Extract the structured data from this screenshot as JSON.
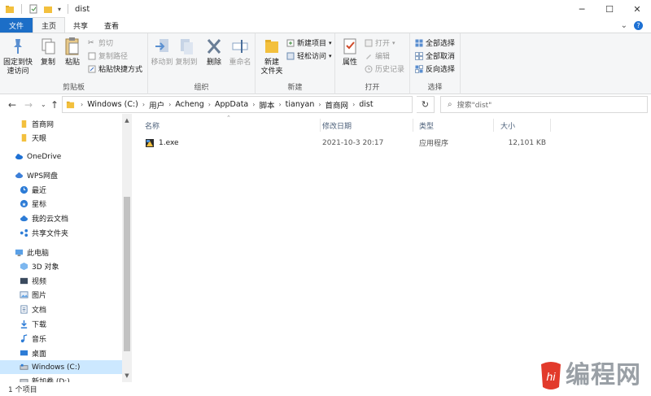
{
  "window": {
    "title": "dist",
    "controls": {
      "minimize": "─",
      "maximize": "☐",
      "close": "✕"
    }
  },
  "ribbon_tabs": [
    {
      "label": "文件"
    },
    {
      "label": "主页"
    },
    {
      "label": "共享"
    },
    {
      "label": "查看"
    }
  ],
  "ribbon": {
    "clipboard": {
      "label": "剪贴板",
      "pin": "固定到快\n速访问",
      "copy": "复制",
      "paste": "粘贴",
      "cut": "剪切",
      "copy_path": "复制路径",
      "paste_shortcut": "粘贴快捷方式"
    },
    "organize": {
      "label": "组织",
      "move_to": "移动到",
      "copy_to": "复制到",
      "delete": "删除",
      "rename": "重命名"
    },
    "new": {
      "label": "新建",
      "new_folder": "新建\n文件夹",
      "new_item": "新建项目",
      "easy_access": "轻松访问"
    },
    "open": {
      "label": "打开",
      "properties": "属性",
      "open": "打开",
      "edit": "编辑",
      "history": "历史记录"
    },
    "select": {
      "label": "选择",
      "select_all": "全部选择",
      "select_none": "全部取消",
      "invert": "反向选择"
    }
  },
  "address": {
    "crumbs": [
      "Windows (C:)",
      "用户",
      "Acheng",
      "AppData",
      "脚本",
      "tianyan",
      "首商网",
      "dist"
    ],
    "search_placeholder": "搜索\"dist\""
  },
  "nav_pane": {
    "items": [
      {
        "label": "首商网",
        "icon": "folder-icon"
      },
      {
        "label": "天眼",
        "icon": "folder-icon"
      },
      {
        "label": "OneDrive",
        "icon": "cloud-icon"
      },
      {
        "label": "WPS网盘",
        "icon": "cloud-icon"
      },
      {
        "label": "最近",
        "icon": "clock-icon"
      },
      {
        "label": "星标",
        "icon": "star-icon"
      },
      {
        "label": "我的云文档",
        "icon": "cloud-icon"
      },
      {
        "label": "共享文件夹",
        "icon": "share-icon"
      },
      {
        "label": "此电脑",
        "icon": "computer-icon"
      },
      {
        "label": "3D 对象",
        "icon": "cube-icon"
      },
      {
        "label": "视频",
        "icon": "video-icon"
      },
      {
        "label": "图片",
        "icon": "picture-icon"
      },
      {
        "label": "文档",
        "icon": "document-icon"
      },
      {
        "label": "下载",
        "icon": "download-icon"
      },
      {
        "label": "音乐",
        "icon": "music-icon"
      },
      {
        "label": "桌面",
        "icon": "desktop-icon"
      },
      {
        "label": "Windows (C:)",
        "icon": "drive-icon"
      },
      {
        "label": "新加卷 (D:)",
        "icon": "drive-icon"
      }
    ]
  },
  "columns": {
    "name": "名称",
    "date": "修改日期",
    "type": "类型",
    "size": "大小"
  },
  "files": [
    {
      "name": "1.exe",
      "date": "2021-10-3 20:17",
      "type": "应用程序",
      "size": "12,101 KB"
    }
  ],
  "status": {
    "count": "1 个项目"
  },
  "watermark": {
    "text": "编程网",
    "logo_text": "hi"
  },
  "colors": {
    "accent": "#1c6ec7",
    "selection": "#cce8ff",
    "folder": "#f3c03d"
  }
}
